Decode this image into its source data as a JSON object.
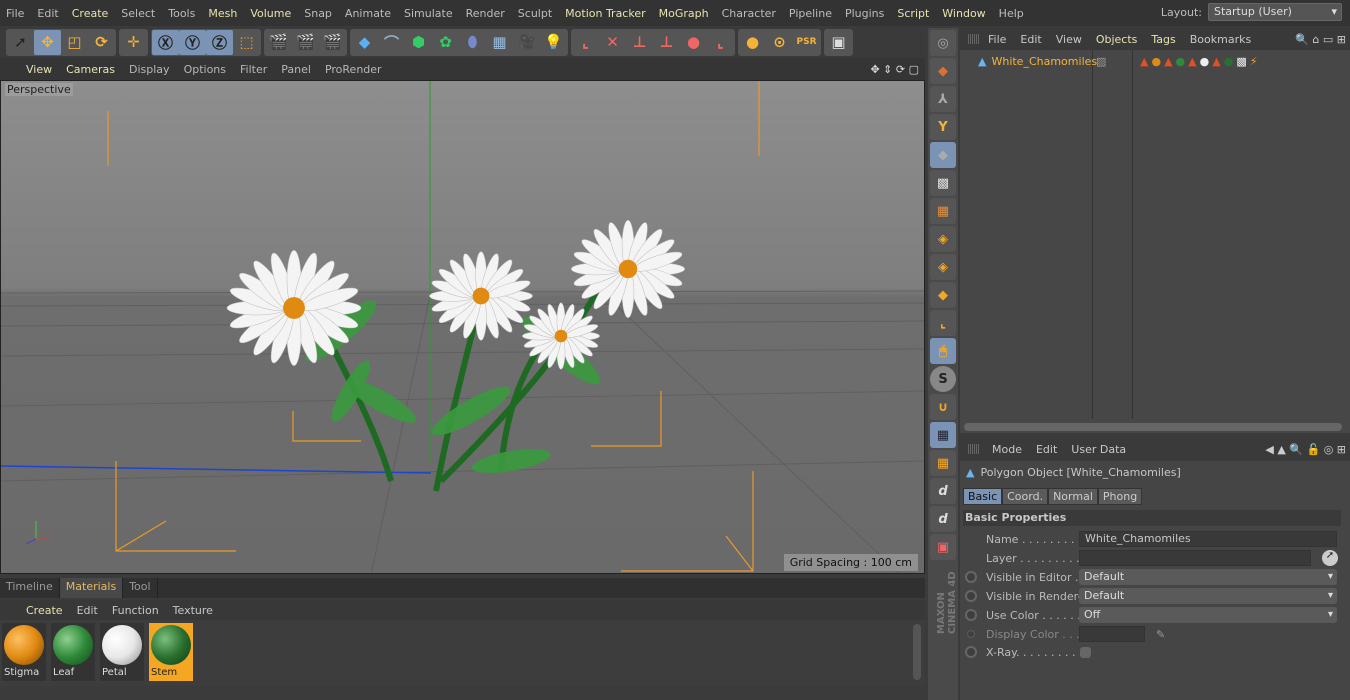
{
  "menu": [
    "File",
    "Edit",
    "Create",
    "Select",
    "Tools",
    "Mesh",
    "Volume",
    "Snap",
    "Animate",
    "Simulate",
    "Render",
    "Sculpt",
    "Motion Tracker",
    "MoGraph",
    "Character",
    "Pipeline",
    "Plugins",
    "Script",
    "Window",
    "Help"
  ],
  "layout": {
    "label": "Layout:",
    "value": "Startup (User)"
  },
  "viewport_menu": [
    "View",
    "Cameras",
    "Display",
    "Options",
    "Filter",
    "Panel",
    "ProRender"
  ],
  "viewport": {
    "camera": "Perspective",
    "grid_spacing": "Grid Spacing : 100 cm"
  },
  "bottom_tabs": [
    "Timeline",
    "Materials",
    "Tool"
  ],
  "material_menu": [
    "Create",
    "Edit",
    "Function",
    "Texture"
  ],
  "materials": [
    {
      "name": "Stigma",
      "color": "#e08a12"
    },
    {
      "name": "Leaf",
      "color": "#2f8a3a"
    },
    {
      "name": "Petal",
      "color": "#eeeeee"
    },
    {
      "name": "Stem",
      "color": "#2a7030"
    }
  ],
  "object_manager": {
    "menu": [
      "File",
      "Edit",
      "View",
      "Objects",
      "Tags",
      "Bookmarks"
    ],
    "object": "White_Chamomiles"
  },
  "attributes": {
    "menu": [
      "Mode",
      "Edit",
      "User Data"
    ],
    "title": "Polygon Object [White_Chamomiles]",
    "tabs": [
      "Basic",
      "Coord.",
      "Normal",
      "Phong"
    ],
    "section": "Basic Properties",
    "fields": {
      "name_label": "Name . . . . . . . . . . .",
      "name_value": "White_Chamomiles",
      "layer_label": "Layer . . . . . . . . . . .",
      "vis_editor_label": "Visible in Editor . . .",
      "vis_editor_value": "Default",
      "vis_render_label": "Visible in Renderer",
      "vis_render_value": "Default",
      "use_color_label": "Use Color . . . . . . .",
      "use_color_value": "Off",
      "display_color_label": "Display Color . . .",
      "xray_label": "X-Ray. . . . . . . . . ."
    }
  },
  "brand": "MAXON CINEMA 4D"
}
